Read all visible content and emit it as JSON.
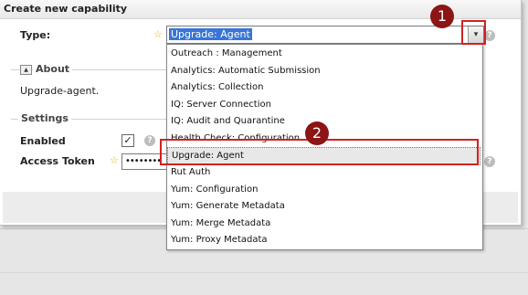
{
  "dialog": {
    "title": "Create new capability",
    "type_label": "Type:",
    "type_value": "Upgrade: Agent",
    "about_legend": "About",
    "about_text": "Upgrade-agent.",
    "settings_legend": "Settings",
    "enabled_label": "Enabled",
    "enabled_checked": true,
    "token_label": "Access Token",
    "token_value": "••••••••",
    "required_marker": "☆",
    "help_glyph": "?",
    "dropdown_arrow": "▾"
  },
  "dropdown": {
    "options": [
      "Outreach : Management",
      "Analytics: Automatic Submission",
      "Analytics: Collection",
      "IQ: Server Connection",
      "IQ: Audit and Quarantine",
      "Health Check: Configuration",
      "Upgrade: Agent",
      "Rut Auth",
      "Yum: Configuration",
      "Yum: Generate Metadata",
      "Yum: Merge Metadata",
      "Yum: Proxy Metadata"
    ],
    "selected": "Upgrade: Agent"
  },
  "annotations": {
    "badge1": "1",
    "badge2": "2",
    "color": "#d42020"
  }
}
